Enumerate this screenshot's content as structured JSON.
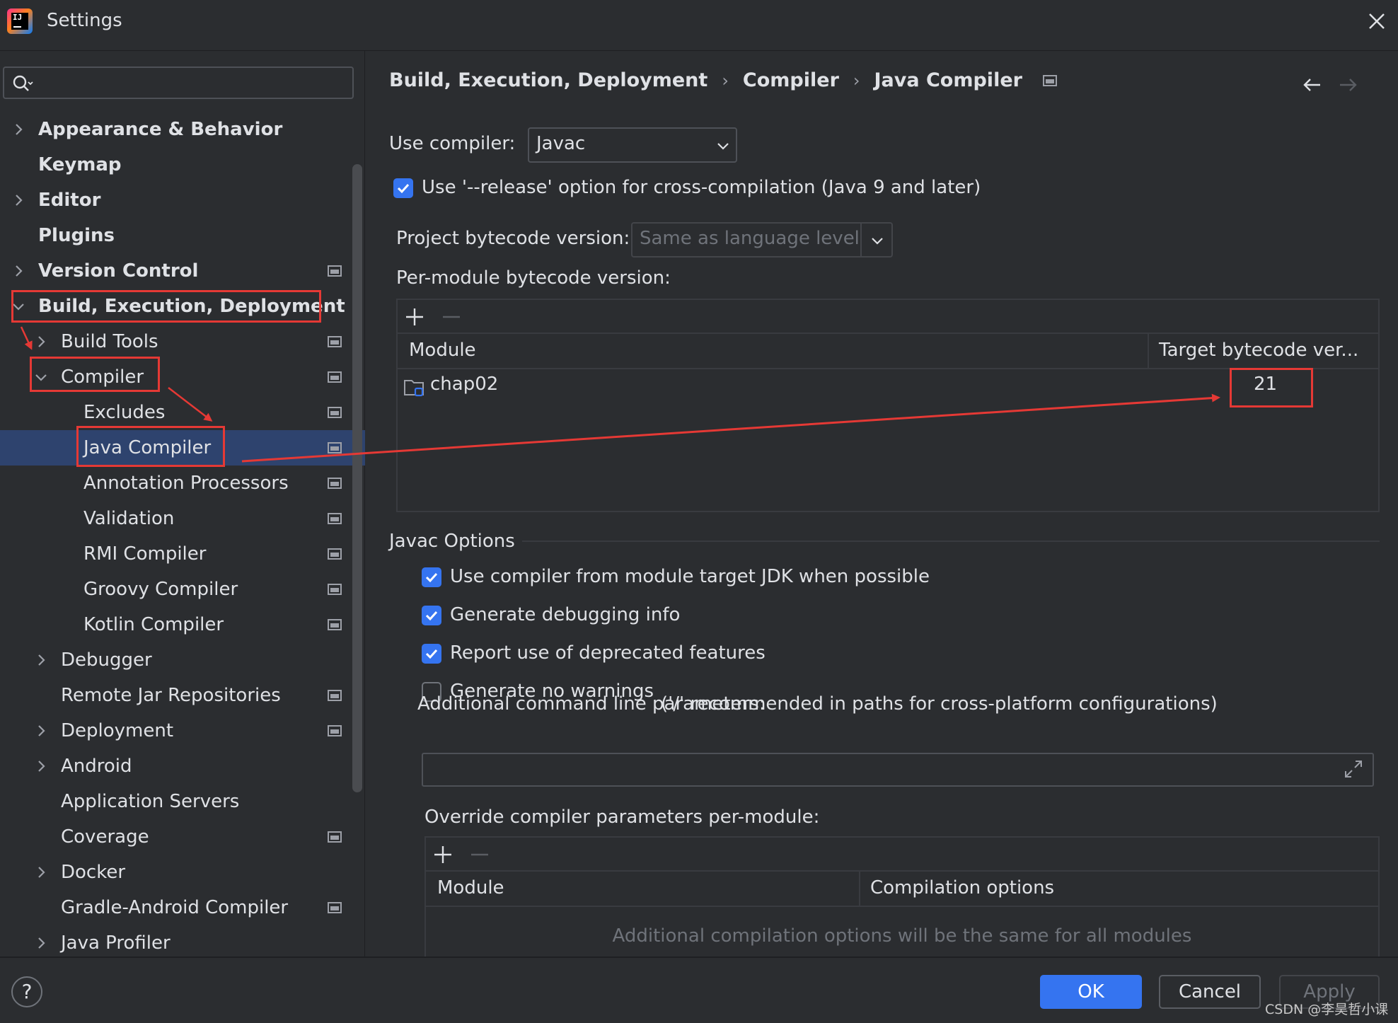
{
  "window": {
    "title": "Settings"
  },
  "sidebar": {
    "items": [
      {
        "label": "Appearance & Behavior",
        "level": 0,
        "chevron": "right",
        "bold": true,
        "project_icon": false
      },
      {
        "label": "Keymap",
        "level": 0,
        "chevron": "none",
        "bold": true,
        "project_icon": false
      },
      {
        "label": "Editor",
        "level": 0,
        "chevron": "right",
        "bold": true,
        "project_icon": false
      },
      {
        "label": "Plugins",
        "level": 0,
        "chevron": "none",
        "bold": true,
        "project_icon": false
      },
      {
        "label": "Version Control",
        "level": 0,
        "chevron": "right",
        "bold": true,
        "project_icon": true
      },
      {
        "label": "Build, Execution, Deployment",
        "level": 0,
        "chevron": "down",
        "bold": true,
        "project_icon": false
      },
      {
        "label": "Build Tools",
        "level": 1,
        "chevron": "right",
        "bold": false,
        "project_icon": true
      },
      {
        "label": "Compiler",
        "level": 1,
        "chevron": "down",
        "bold": false,
        "project_icon": true
      },
      {
        "label": "Excludes",
        "level": 2,
        "chevron": "none",
        "bold": false,
        "project_icon": true
      },
      {
        "label": "Java Compiler",
        "level": 2,
        "chevron": "none",
        "bold": false,
        "project_icon": true,
        "selected": true
      },
      {
        "label": "Annotation Processors",
        "level": 2,
        "chevron": "none",
        "bold": false,
        "project_icon": true
      },
      {
        "label": "Validation",
        "level": 2,
        "chevron": "none",
        "bold": false,
        "project_icon": true
      },
      {
        "label": "RMI Compiler",
        "level": 2,
        "chevron": "none",
        "bold": false,
        "project_icon": true
      },
      {
        "label": "Groovy Compiler",
        "level": 2,
        "chevron": "none",
        "bold": false,
        "project_icon": true
      },
      {
        "label": "Kotlin Compiler",
        "level": 2,
        "chevron": "none",
        "bold": false,
        "project_icon": true
      },
      {
        "label": "Debugger",
        "level": 1,
        "chevron": "right",
        "bold": false,
        "project_icon": false
      },
      {
        "label": "Remote Jar Repositories",
        "level": 1,
        "chevron": "none",
        "bold": false,
        "project_icon": true
      },
      {
        "label": "Deployment",
        "level": 1,
        "chevron": "right",
        "bold": false,
        "project_icon": true
      },
      {
        "label": "Android",
        "level": 1,
        "chevron": "right",
        "bold": false,
        "project_icon": false
      },
      {
        "label": "Application Servers",
        "level": 1,
        "chevron": "none",
        "bold": false,
        "project_icon": false
      },
      {
        "label": "Coverage",
        "level": 1,
        "chevron": "none",
        "bold": false,
        "project_icon": true
      },
      {
        "label": "Docker",
        "level": 1,
        "chevron": "right",
        "bold": false,
        "project_icon": false
      },
      {
        "label": "Gradle-Android Compiler",
        "level": 1,
        "chevron": "none",
        "bold": false,
        "project_icon": true
      },
      {
        "label": "Java Profiler",
        "level": 1,
        "chevron": "right",
        "bold": false,
        "project_icon": false
      }
    ]
  },
  "breadcrumb": {
    "parts": [
      "Build, Execution, Deployment",
      "Compiler",
      "Java Compiler"
    ],
    "separator": "›"
  },
  "compiler": {
    "use_compiler_label": "Use compiler:",
    "use_compiler_value": "Javac",
    "release_option_label": "Use '--release' option for cross-compilation (Java 9 and later)",
    "release_option_checked": true,
    "project_bytecode_label": "Project bytecode version:",
    "project_bytecode_placeholder": "Same as language level",
    "per_module_label": "Per-module bytecode version:",
    "module_table": {
      "columns": [
        "Module",
        "Target bytecode ver..."
      ],
      "rows": [
        {
          "module": "chap02",
          "target": "21"
        }
      ]
    }
  },
  "javac_options": {
    "title": "Javac Options",
    "checkboxes": [
      {
        "label": "Use compiler from module target JDK when possible",
        "checked": true
      },
      {
        "label": "Generate debugging info",
        "checked": true
      },
      {
        "label": "Report use of deprecated features",
        "checked": true
      },
      {
        "label": "Generate no warnings",
        "checked": false
      }
    ],
    "additional_params_label": "Additional command line parameters:",
    "additional_params_hint": "('/' recommended in paths for cross-platform configurations)",
    "additional_params_value": "",
    "override_label": "Override compiler parameters per-module:",
    "override_table": {
      "columns": [
        "Module",
        "Compilation options"
      ],
      "empty_text": "Additional compilation options will be the same for all modules"
    }
  },
  "buttons": {
    "ok": "OK",
    "cancel": "Cancel",
    "apply": "Apply",
    "help": "?"
  },
  "watermark": "CSDN @李昊哲小课",
  "colors": {
    "accent": "#3574f0",
    "selection": "#2e436e",
    "annotation": "#e53935"
  }
}
